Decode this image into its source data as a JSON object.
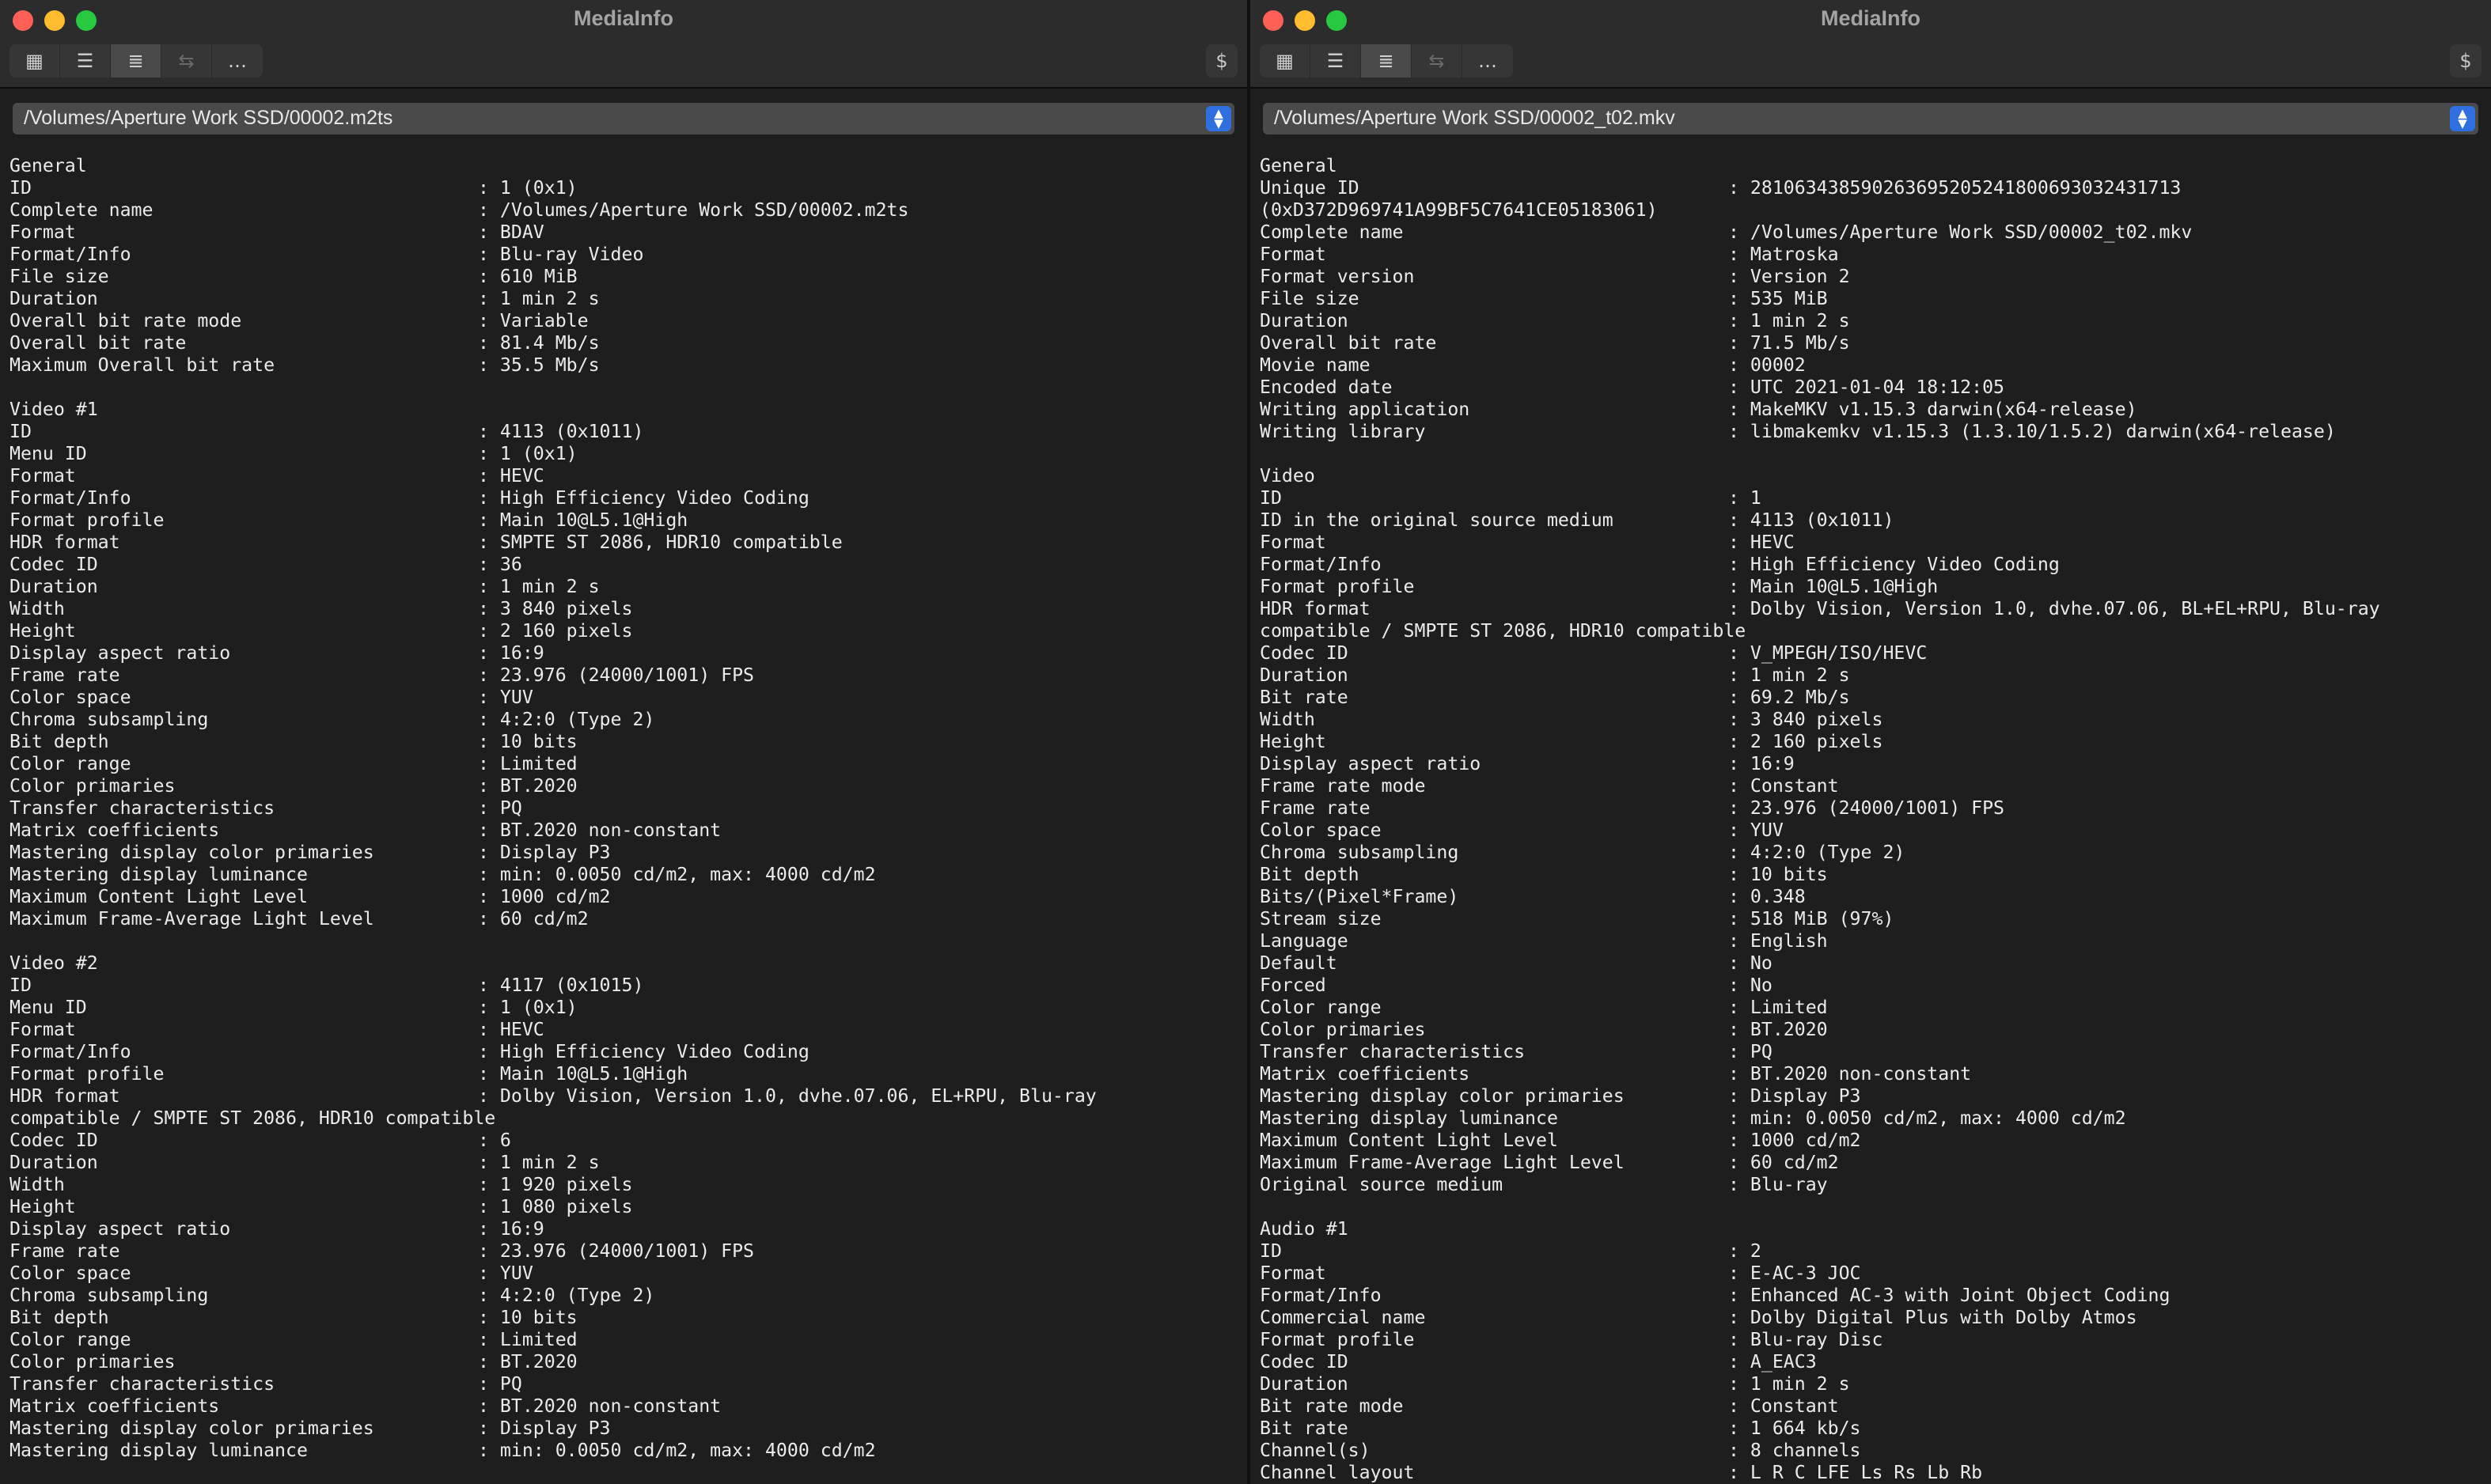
{
  "left": {
    "title": "MediaInfo",
    "path": "/Volumes/Aperture Work SSD/00002.m2ts",
    "lines": [
      [
        "General",
        ""
      ],
      [
        "ID",
        "1 (0x1)"
      ],
      [
        "Complete name",
        "/Volumes/Aperture Work SSD/00002.m2ts"
      ],
      [
        "Format",
        "BDAV"
      ],
      [
        "Format/Info",
        "Blu-ray Video"
      ],
      [
        "File size",
        "610 MiB"
      ],
      [
        "Duration",
        "1 min 2 s"
      ],
      [
        "Overall bit rate mode",
        "Variable"
      ],
      [
        "Overall bit rate",
        "81.4 Mb/s"
      ],
      [
        "Maximum Overall bit rate",
        "35.5 Mb/s"
      ],
      [
        "",
        ""
      ],
      [
        "Video #1",
        ""
      ],
      [
        "ID",
        "4113 (0x1011)"
      ],
      [
        "Menu ID",
        "1 (0x1)"
      ],
      [
        "Format",
        "HEVC"
      ],
      [
        "Format/Info",
        "High Efficiency Video Coding"
      ],
      [
        "Format profile",
        "Main 10@L5.1@High"
      ],
      [
        "HDR format",
        "SMPTE ST 2086, HDR10 compatible"
      ],
      [
        "Codec ID",
        "36"
      ],
      [
        "Duration",
        "1 min 2 s"
      ],
      [
        "Width",
        "3 840 pixels"
      ],
      [
        "Height",
        "2 160 pixels"
      ],
      [
        "Display aspect ratio",
        "16:9"
      ],
      [
        "Frame rate",
        "23.976 (24000/1001) FPS"
      ],
      [
        "Color space",
        "YUV"
      ],
      [
        "Chroma subsampling",
        "4:2:0 (Type 2)"
      ],
      [
        "Bit depth",
        "10 bits"
      ],
      [
        "Color range",
        "Limited"
      ],
      [
        "Color primaries",
        "BT.2020"
      ],
      [
        "Transfer characteristics",
        "PQ"
      ],
      [
        "Matrix coefficients",
        "BT.2020 non-constant"
      ],
      [
        "Mastering display color primaries",
        "Display P3"
      ],
      [
        "Mastering display luminance",
        "min: 0.0050 cd/m2, max: 4000 cd/m2"
      ],
      [
        "Maximum Content Light Level",
        "1000 cd/m2"
      ],
      [
        "Maximum Frame-Average Light Level",
        "60 cd/m2"
      ],
      [
        "",
        ""
      ],
      [
        "Video #2",
        ""
      ],
      [
        "ID",
        "4117 (0x1015)"
      ],
      [
        "Menu ID",
        "1 (0x1)"
      ],
      [
        "Format",
        "HEVC"
      ],
      [
        "Format/Info",
        "High Efficiency Video Coding"
      ],
      [
        "Format profile",
        "Main 10@L5.1@High"
      ],
      [
        "HDR format",
        "Dolby Vision, Version 1.0, dvhe.07.06, EL+RPU, Blu-ray"
      ],
      [
        "compatible / SMPTE ST 2086, HDR10 compatible",
        ""
      ],
      [
        "Codec ID",
        "6"
      ],
      [
        "Duration",
        "1 min 2 s"
      ],
      [
        "Width",
        "1 920 pixels"
      ],
      [
        "Height",
        "1 080 pixels"
      ],
      [
        "Display aspect ratio",
        "16:9"
      ],
      [
        "Frame rate",
        "23.976 (24000/1001) FPS"
      ],
      [
        "Color space",
        "YUV"
      ],
      [
        "Chroma subsampling",
        "4:2:0 (Type 2)"
      ],
      [
        "Bit depth",
        "10 bits"
      ],
      [
        "Color range",
        "Limited"
      ],
      [
        "Color primaries",
        "BT.2020"
      ],
      [
        "Transfer characteristics",
        "PQ"
      ],
      [
        "Matrix coefficients",
        "BT.2020 non-constant"
      ],
      [
        "Mastering display color primaries",
        "Display P3"
      ],
      [
        "Mastering display luminance",
        "min: 0.0050 cd/m2, max: 4000 cd/m2"
      ]
    ]
  },
  "right": {
    "title": "MediaInfo",
    "path": "/Volumes/Aperture Work SSD/00002_t02.mkv",
    "lines": [
      [
        "General",
        ""
      ],
      [
        "Unique ID",
        "281063438590263695205241800693032431713"
      ],
      [
        "(0xD372D969741A99BF5C7641CE05183061)",
        ""
      ],
      [
        "Complete name",
        "/Volumes/Aperture Work SSD/00002_t02.mkv"
      ],
      [
        "Format",
        "Matroska"
      ],
      [
        "Format version",
        "Version 2"
      ],
      [
        "File size",
        "535 MiB"
      ],
      [
        "Duration",
        "1 min 2 s"
      ],
      [
        "Overall bit rate",
        "71.5 Mb/s"
      ],
      [
        "Movie name",
        "00002"
      ],
      [
        "Encoded date",
        "UTC 2021-01-04 18:12:05"
      ],
      [
        "Writing application",
        "MakeMKV v1.15.3 darwin(x64-release)"
      ],
      [
        "Writing library",
        "libmakemkv v1.15.3 (1.3.10/1.5.2) darwin(x64-release)"
      ],
      [
        "",
        ""
      ],
      [
        "Video",
        ""
      ],
      [
        "ID",
        "1"
      ],
      [
        "ID in the original source medium",
        "4113 (0x1011)"
      ],
      [
        "Format",
        "HEVC"
      ],
      [
        "Format/Info",
        "High Efficiency Video Coding"
      ],
      [
        "Format profile",
        "Main 10@L5.1@High"
      ],
      [
        "HDR format",
        "Dolby Vision, Version 1.0, dvhe.07.06, BL+EL+RPU, Blu-ray"
      ],
      [
        "compatible / SMPTE ST 2086, HDR10 compatible",
        ""
      ],
      [
        "Codec ID",
        "V_MPEGH/ISO/HEVC"
      ],
      [
        "Duration",
        "1 min 2 s"
      ],
      [
        "Bit rate",
        "69.2 Mb/s"
      ],
      [
        "Width",
        "3 840 pixels"
      ],
      [
        "Height",
        "2 160 pixels"
      ],
      [
        "Display aspect ratio",
        "16:9"
      ],
      [
        "Frame rate mode",
        "Constant"
      ],
      [
        "Frame rate",
        "23.976 (24000/1001) FPS"
      ],
      [
        "Color space",
        "YUV"
      ],
      [
        "Chroma subsampling",
        "4:2:0 (Type 2)"
      ],
      [
        "Bit depth",
        "10 bits"
      ],
      [
        "Bits/(Pixel*Frame)",
        "0.348"
      ],
      [
        "Stream size",
        "518 MiB (97%)"
      ],
      [
        "Language",
        "English"
      ],
      [
        "Default",
        "No"
      ],
      [
        "Forced",
        "No"
      ],
      [
        "Color range",
        "Limited"
      ],
      [
        "Color primaries",
        "BT.2020"
      ],
      [
        "Transfer characteristics",
        "PQ"
      ],
      [
        "Matrix coefficients",
        "BT.2020 non-constant"
      ],
      [
        "Mastering display color primaries",
        "Display P3"
      ],
      [
        "Mastering display luminance",
        "min: 0.0050 cd/m2, max: 4000 cd/m2"
      ],
      [
        "Maximum Content Light Level",
        "1000 cd/m2"
      ],
      [
        "Maximum Frame-Average Light Level",
        "60 cd/m2"
      ],
      [
        "Original source medium",
        "Blu-ray"
      ],
      [
        "",
        ""
      ],
      [
        "Audio #1",
        ""
      ],
      [
        "ID",
        "2"
      ],
      [
        "Format",
        "E-AC-3 JOC"
      ],
      [
        "Format/Info",
        "Enhanced AC-3 with Joint Object Coding"
      ],
      [
        "Commercial name",
        "Dolby Digital Plus with Dolby Atmos"
      ],
      [
        "Format profile",
        "Blu-ray Disc"
      ],
      [
        "Codec ID",
        "A_EAC3"
      ],
      [
        "Duration",
        "1 min 2 s"
      ],
      [
        "Bit rate mode",
        "Constant"
      ],
      [
        "Bit rate",
        "1 664 kb/s"
      ],
      [
        "Channel(s)",
        "8 channels"
      ],
      [
        "Channel layout",
        "L R C LFE Ls Rs Lb Rb"
      ]
    ]
  },
  "toolbar": {
    "buttons": [
      {
        "name": "view-grid-button",
        "icon": "grid-icon",
        "glyph": "▦",
        "active": false,
        "disabled": false
      },
      {
        "name": "view-tree-button",
        "icon": "tree-list-icon",
        "glyph": "☰",
        "active": false,
        "disabled": false
      },
      {
        "name": "view-text-button",
        "icon": "text-list-icon",
        "glyph": "≣",
        "active": true,
        "disabled": false
      },
      {
        "name": "view-compare-button",
        "icon": "compare-arrows-icon",
        "glyph": "⇆",
        "active": false,
        "disabled": true
      },
      {
        "name": "more-button",
        "icon": "ellipsis-icon",
        "glyph": "…",
        "active": false,
        "disabled": false
      }
    ],
    "right_glyph": "$"
  },
  "colors": {
    "background": "#1e1e1e",
    "titlebar": "#2c2c2c",
    "text": "#ebebeb",
    "accent": "#2f6fe0"
  }
}
